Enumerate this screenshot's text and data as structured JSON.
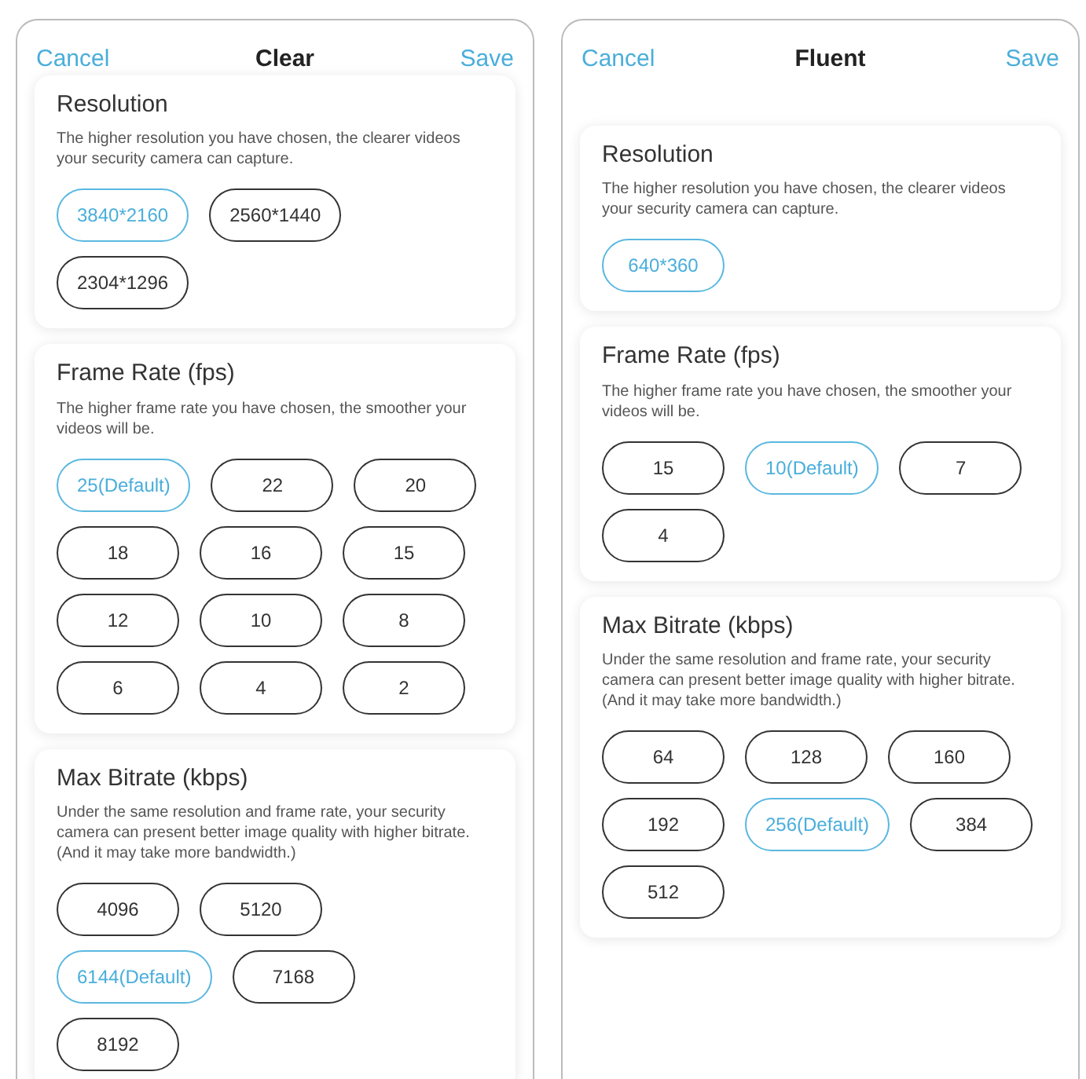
{
  "screens": [
    {
      "cancel": "Cancel",
      "title": "Clear",
      "save": "Save",
      "scrolled": true,
      "sections": [
        {
          "heading": "Resolution",
          "description": "The higher resolution you have chosen, the clearer videos your security camera can capture.",
          "rows": [
            [
              {
                "label": "3840*2160",
                "selected": true
              },
              {
                "label": "2560*1440",
                "selected": false
              }
            ],
            [
              {
                "label": "2304*1296",
                "selected": false
              }
            ]
          ]
        },
        {
          "heading": "Frame Rate (fps)",
          "description": "The higher frame rate you have chosen, the smoother your videos will be.",
          "rows": [
            [
              {
                "label": "25(Default)",
                "selected": true
              },
              {
                "label": "22",
                "selected": false
              },
              {
                "label": "20",
                "selected": false
              }
            ],
            [
              {
                "label": "18",
                "selected": false
              },
              {
                "label": "16",
                "selected": false
              },
              {
                "label": "15",
                "selected": false
              }
            ],
            [
              {
                "label": "12",
                "selected": false
              },
              {
                "label": "10",
                "selected": false
              },
              {
                "label": "8",
                "selected": false
              }
            ],
            [
              {
                "label": "6",
                "selected": false
              },
              {
                "label": "4",
                "selected": false
              },
              {
                "label": "2",
                "selected": false
              }
            ]
          ]
        },
        {
          "heading": "Max Bitrate (kbps)",
          "description": "Under the same resolution and frame rate, your security camera can present better image quality with higher bitrate. (And it may take more bandwidth.)",
          "rows": [
            [
              {
                "label": "4096",
                "selected": false
              },
              {
                "label": "5120",
                "selected": false
              }
            ],
            [
              {
                "label": "6144(Default)",
                "selected": true
              },
              {
                "label": "7168",
                "selected": false
              }
            ],
            [
              {
                "label": "8192",
                "selected": false
              }
            ]
          ]
        }
      ]
    },
    {
      "cancel": "Cancel",
      "title": "Fluent",
      "save": "Save",
      "scrolled": false,
      "sections": [
        {
          "heading": "Resolution",
          "description": "The higher resolution you have chosen, the clearer videos your security camera can capture.",
          "rows": [
            [
              {
                "label": "640*360",
                "selected": true
              }
            ]
          ]
        },
        {
          "heading": "Frame Rate (fps)",
          "description": "The higher frame rate you have chosen, the smoother your videos will be.",
          "rows": [
            [
              {
                "label": "15",
                "selected": false
              },
              {
                "label": "10(Default)",
                "selected": true
              },
              {
                "label": "7",
                "selected": false
              }
            ],
            [
              {
                "label": "4",
                "selected": false
              }
            ]
          ]
        },
        {
          "heading": "Max Bitrate (kbps)",
          "description": "Under the same resolution and frame rate, your security camera can present better image quality with higher bitrate. (And it may take more bandwidth.)",
          "rows": [
            [
              {
                "label": "64",
                "selected": false
              },
              {
                "label": "128",
                "selected": false
              },
              {
                "label": "160",
                "selected": false
              }
            ],
            [
              {
                "label": "192",
                "selected": false
              },
              {
                "label": "256(Default)",
                "selected": true
              },
              {
                "label": "384",
                "selected": false
              }
            ],
            [
              {
                "label": "512",
                "selected": false
              }
            ]
          ]
        }
      ]
    }
  ]
}
